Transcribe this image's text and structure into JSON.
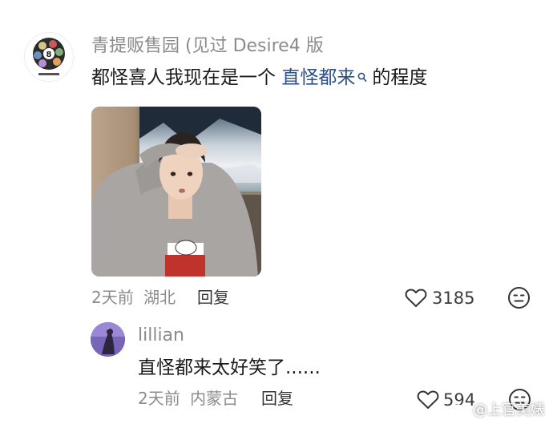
{
  "main_comment": {
    "username": "青提贩售园 (见过 Desire4 版",
    "text_before": "都怪喜人我现在是一个 ",
    "link_text": "直怪都来",
    "text_after": "的程度",
    "date": "2天前",
    "location": "湖北",
    "reply_label": "回复",
    "like_count": "3185"
  },
  "reply_comment": {
    "username": "lillian",
    "text": "直怪都来太好笑了......",
    "date": "2天前",
    "location": "内蒙古",
    "reply_label": "回复",
    "like_count": "594"
  },
  "watermark": {
    "text": "@上官美婊"
  },
  "colors": {
    "link": "#2d4f87",
    "meta": "#8c8c8c",
    "username": "#8b8b8b"
  }
}
